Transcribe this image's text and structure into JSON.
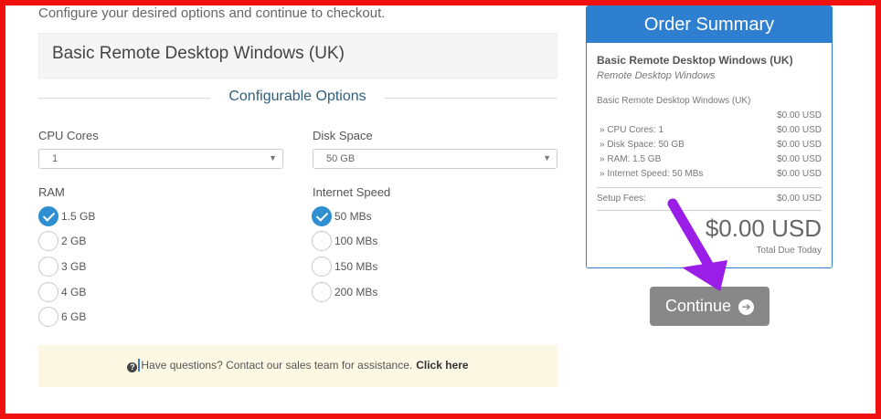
{
  "intro_text": "Configure your desired options and continue to checkout.",
  "product_name": "Basic Remote Desktop Windows (UK)",
  "configurable_options_title": "Configurable Options",
  "fields": {
    "cpu": {
      "label": "CPU Cores",
      "selected": "1"
    },
    "disk": {
      "label": "Disk Space",
      "selected": "50 GB"
    },
    "ram": {
      "label": "RAM",
      "options": [
        "1.5 GB",
        "2 GB",
        "3 GB",
        "4 GB",
        "6 GB"
      ],
      "selected": "1.5 GB"
    },
    "internet": {
      "label": "Internet Speed",
      "options": [
        "50 MBs",
        "100 MBs",
        "150 MBs",
        "200 MBs"
      ],
      "selected": "50 MBs"
    }
  },
  "help": {
    "icon": "question-circle-icon",
    "text": "Have questions? Contact our sales team for assistance.",
    "link": "Click here"
  },
  "summary": {
    "title": "Order Summary",
    "product": "Basic Remote Desktop Windows (UK)",
    "group": "Remote Desktop Windows",
    "line_item": "Basic Remote Desktop Windows (UK)",
    "base_price": "$0.00 USD",
    "items": [
      {
        "label": "» CPU Cores: 1",
        "price": "$0.00 USD"
      },
      {
        "label": "» Disk Space: 50 GB",
        "price": "$0.00 USD"
      },
      {
        "label": "» RAM: 1.5 GB",
        "price": "$0.00 USD"
      },
      {
        "label": "» Internet Speed: 50 MBs",
        "price": "$0.00 USD"
      }
    ],
    "setup_label": "Setup Fees:",
    "setup_price": "$0.00 USD",
    "total": "$0.00 USD",
    "total_label": "Total Due Today"
  },
  "continue_label": "Continue",
  "colors": {
    "accent": "#2f7fd0",
    "frame": "#f01010",
    "arrow": "#9b1ee8",
    "button": "#888888",
    "help_bg": "#fcf8e3"
  }
}
